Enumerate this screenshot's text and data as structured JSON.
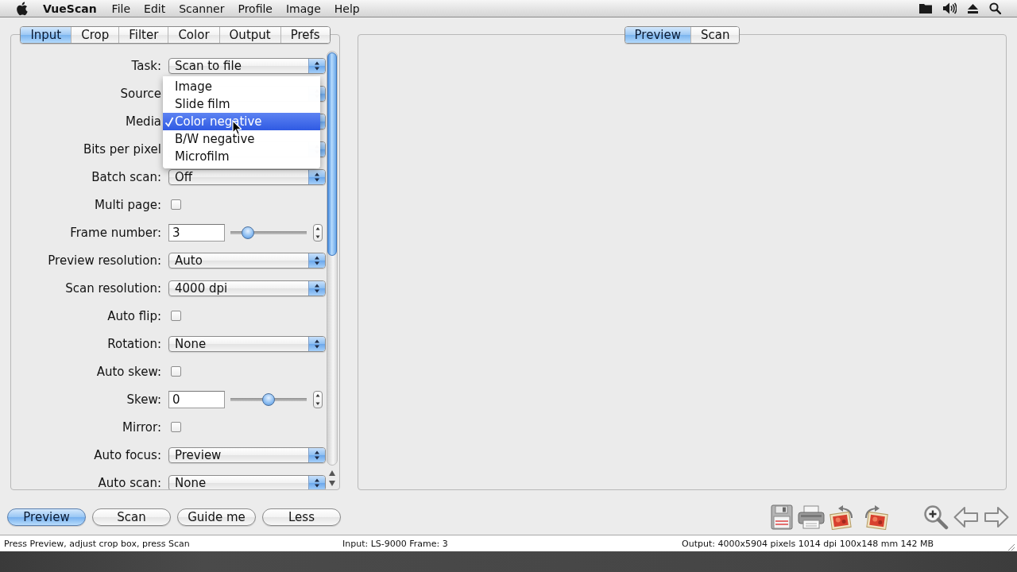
{
  "menu_bar": {
    "app_name": "VueScan",
    "menus": [
      "File",
      "Edit",
      "Scanner",
      "Profile",
      "Image",
      "Help"
    ]
  },
  "settings_panel": {
    "tabs": [
      {
        "label": "Input",
        "selected": true
      },
      {
        "label": "Crop",
        "selected": false
      },
      {
        "label": "Filter",
        "selected": false
      },
      {
        "label": "Color",
        "selected": false
      },
      {
        "label": "Output",
        "selected": false
      },
      {
        "label": "Prefs",
        "selected": false
      }
    ],
    "rows": [
      {
        "kind": "popup",
        "label": "Task:",
        "value": "Scan to file"
      },
      {
        "kind": "popup",
        "label": "Source"
      },
      {
        "kind": "popup",
        "label": "Media",
        "menu": [
          {
            "label": "Image",
            "selected": false
          },
          {
            "label": "Slide film",
            "selected": false
          },
          {
            "label": "Color negative",
            "selected": true
          },
          {
            "label": "B/W negative",
            "selected": false
          },
          {
            "label": "Microfilm",
            "selected": false
          }
        ]
      },
      {
        "kind": "popup",
        "label": "Bits per pixel"
      },
      {
        "kind": "popup",
        "label": "Batch scan:",
        "value": "Off"
      },
      {
        "kind": "checkbox",
        "label": "Multi page:",
        "checked": false
      },
      {
        "kind": "slider",
        "label": "Frame number:",
        "value": "3",
        "level": 0.18
      },
      {
        "kind": "popup",
        "label": "Preview resolution:",
        "value": "Auto"
      },
      {
        "kind": "popup",
        "label": "Scan resolution:",
        "value": "4000 dpi"
      },
      {
        "kind": "checkbox",
        "label": "Auto flip:",
        "checked": false
      },
      {
        "kind": "popup",
        "label": "Rotation:",
        "value": "None"
      },
      {
        "kind": "checkbox",
        "label": "Auto skew:",
        "checked": false
      },
      {
        "kind": "slider",
        "label": "Skew:",
        "value": "0",
        "level": 0.5
      },
      {
        "kind": "checkbox",
        "label": "Mirror:",
        "checked": false
      },
      {
        "kind": "popup",
        "label": "Auto focus:",
        "value": "Preview"
      },
      {
        "kind": "popup",
        "label": "Auto scan:",
        "value": "None"
      }
    ]
  },
  "preview_panel": {
    "tabs": [
      {
        "label": "Preview",
        "selected": true
      },
      {
        "label": "Scan",
        "selected": false
      }
    ]
  },
  "buttons": [
    {
      "label": "Preview",
      "default": true
    },
    {
      "label": "Scan",
      "default": false
    },
    {
      "label": "Guide me",
      "default": false
    },
    {
      "label": "Less",
      "default": false
    }
  ],
  "status_bar": [
    "Press Preview, adjust crop box, press Scan",
    "Input: LS-9000 Frame: 3",
    "Output: 4000x5904 pixels 1014 dpi 100x148 mm 142 MB"
  ]
}
